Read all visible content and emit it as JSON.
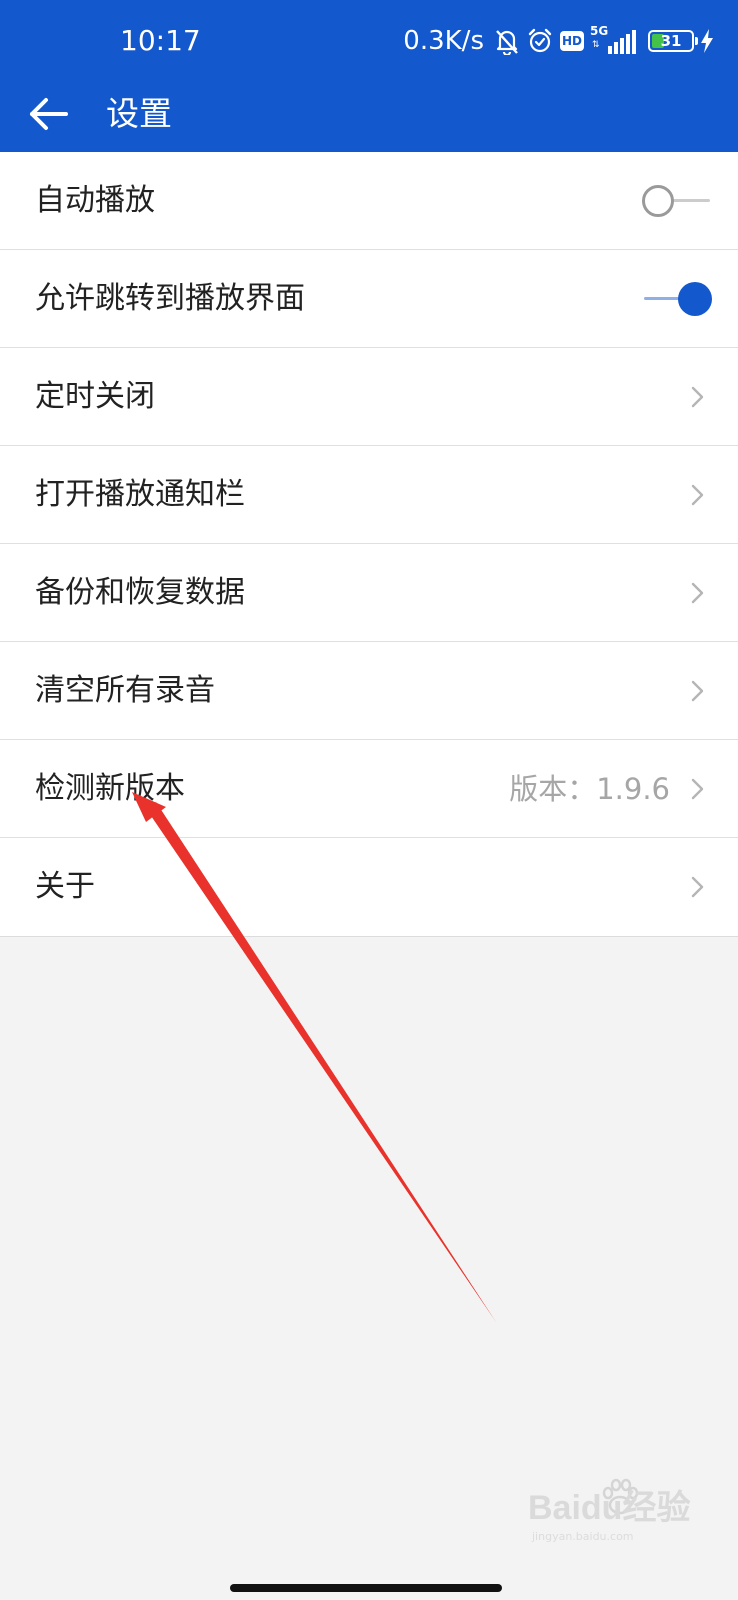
{
  "status_bar": {
    "time": "10:17",
    "net_speed": "0.3K/s",
    "icons": [
      "bell-off-icon",
      "alarm-icon",
      "hd-icon",
      "signal-5g-icon",
      "battery-icon",
      "charging-icon"
    ],
    "hd_label": "HD",
    "network_label": "5G",
    "battery_level": "31",
    "battery_fraction": 0.31
  },
  "toolbar": {
    "title": "设置",
    "back_icon": "arrow-left-icon"
  },
  "settings": {
    "items": [
      {
        "label": "自动播放",
        "control": "switch",
        "on": false
      },
      {
        "label": "允许跳转到播放界面",
        "control": "switch",
        "on": true
      },
      {
        "label": "定时关闭",
        "control": "chevron"
      },
      {
        "label": "打开播放通知栏",
        "control": "chevron"
      },
      {
        "label": "备份和恢复数据",
        "control": "chevron"
      },
      {
        "label": "清空所有录音",
        "control": "chevron"
      },
      {
        "label": "检测新版本",
        "control": "chevron",
        "value": "版本：1.9.6"
      },
      {
        "label": "关于",
        "control": "chevron"
      }
    ]
  },
  "watermark": {
    "text": "Baidu经验",
    "sub": "jingyan.baidu.com"
  },
  "colors": {
    "primary": "#1358cc",
    "background": "#f3f3f3",
    "annotation": "#e8322b",
    "charging_green": "#45c24a"
  }
}
